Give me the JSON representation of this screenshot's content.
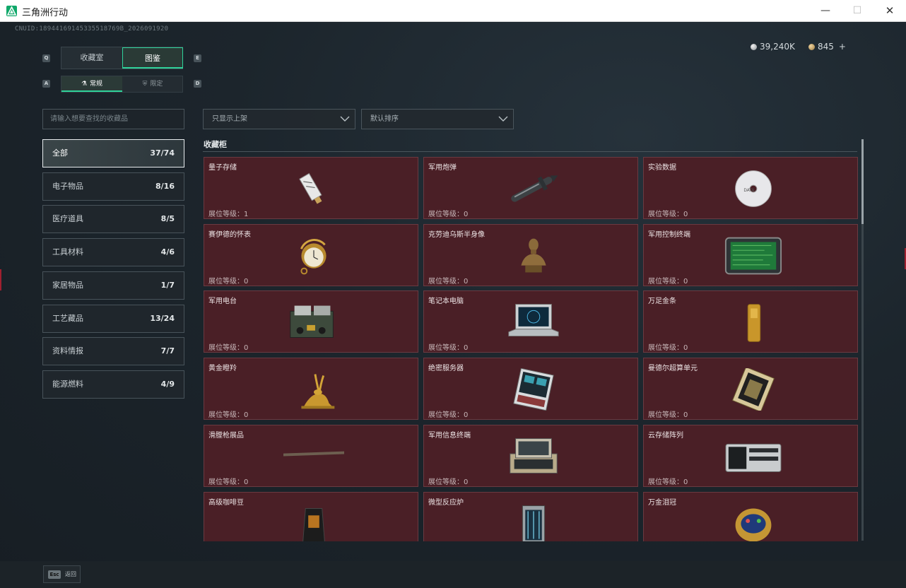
{
  "window": {
    "title": "三角洲行动",
    "minimize": "—",
    "maximize": "☐",
    "close": "✕"
  },
  "cnuid": "CNUID:18944169145335518769B_2026091920",
  "tabs_main": {
    "key_left": "Q",
    "key_right": "E",
    "items": [
      {
        "label": "收藏室",
        "active": false
      },
      {
        "label": "图鉴",
        "active": true
      }
    ]
  },
  "tabs_sub": {
    "key_left": "A",
    "key_right": "D",
    "items": [
      {
        "label": "常规",
        "icon": "⚗",
        "active": true
      },
      {
        "label": "限定",
        "icon": "⛨",
        "active": false
      }
    ]
  },
  "currency": [
    {
      "value": "39,240K",
      "icon": "silver-coin-icon"
    },
    {
      "value": "845",
      "icon": "gold-coin-icon",
      "plus": "+"
    }
  ],
  "search": {
    "placeholder": "请输入想要查找的收藏品"
  },
  "filters": [
    {
      "label": "只显示上架"
    },
    {
      "label": "默认排序"
    }
  ],
  "categories": [
    {
      "label": "全部",
      "count": "37/74",
      "active": true
    },
    {
      "label": "电子物品",
      "count": "8/16",
      "active": false
    },
    {
      "label": "医疗道具",
      "count": "8/5",
      "active": false
    },
    {
      "label": "工具材料",
      "count": "4/6",
      "active": false
    },
    {
      "label": "家居物品",
      "count": "1/7",
      "active": false
    },
    {
      "label": "工艺藏品",
      "count": "13/24",
      "active": false
    },
    {
      "label": "资料情报",
      "count": "7/7",
      "active": false
    },
    {
      "label": "能源燃料",
      "count": "4/9",
      "active": false
    }
  ],
  "section_title": "收藏柜",
  "level_prefix": "展位等级：",
  "items": [
    {
      "name": "量子存储",
      "level": "1",
      "art": "usb"
    },
    {
      "name": "军用炮弹",
      "level": "0",
      "art": "shell"
    },
    {
      "name": "实验数据",
      "level": "0",
      "art": "disc"
    },
    {
      "name": "赛伊德的怀表",
      "level": "0",
      "art": "watch"
    },
    {
      "name": "克劳迪乌斯半身像",
      "level": "0",
      "art": "bust"
    },
    {
      "name": "军用控制终端",
      "level": "0",
      "art": "terminal"
    },
    {
      "name": "军用电台",
      "level": "0",
      "art": "radio"
    },
    {
      "name": "笔记本电脑",
      "level": "0",
      "art": "laptop"
    },
    {
      "name": "万足金条",
      "level": "0",
      "art": "goldbar"
    },
    {
      "name": "黄金瞪羚",
      "level": "0",
      "art": "gazelle"
    },
    {
      "name": "绝密服务器",
      "level": "0",
      "art": "server"
    },
    {
      "name": "曼德尔超算单元",
      "level": "0",
      "art": "cpu"
    },
    {
      "name": "滑膛枪展品",
      "level": "0",
      "art": "musket"
    },
    {
      "name": "军用信息终端",
      "level": "0",
      "art": "case"
    },
    {
      "name": "云存储阵列",
      "level": "0",
      "art": "storage"
    },
    {
      "name": "高级咖啡豆",
      "level": "",
      "art": "coffee"
    },
    {
      "name": "微型反应炉",
      "level": "",
      "art": "reactor"
    },
    {
      "name": "万金泪冠",
      "level": "",
      "art": "egg"
    }
  ],
  "footer": {
    "key": "Esc",
    "label": "返回"
  }
}
